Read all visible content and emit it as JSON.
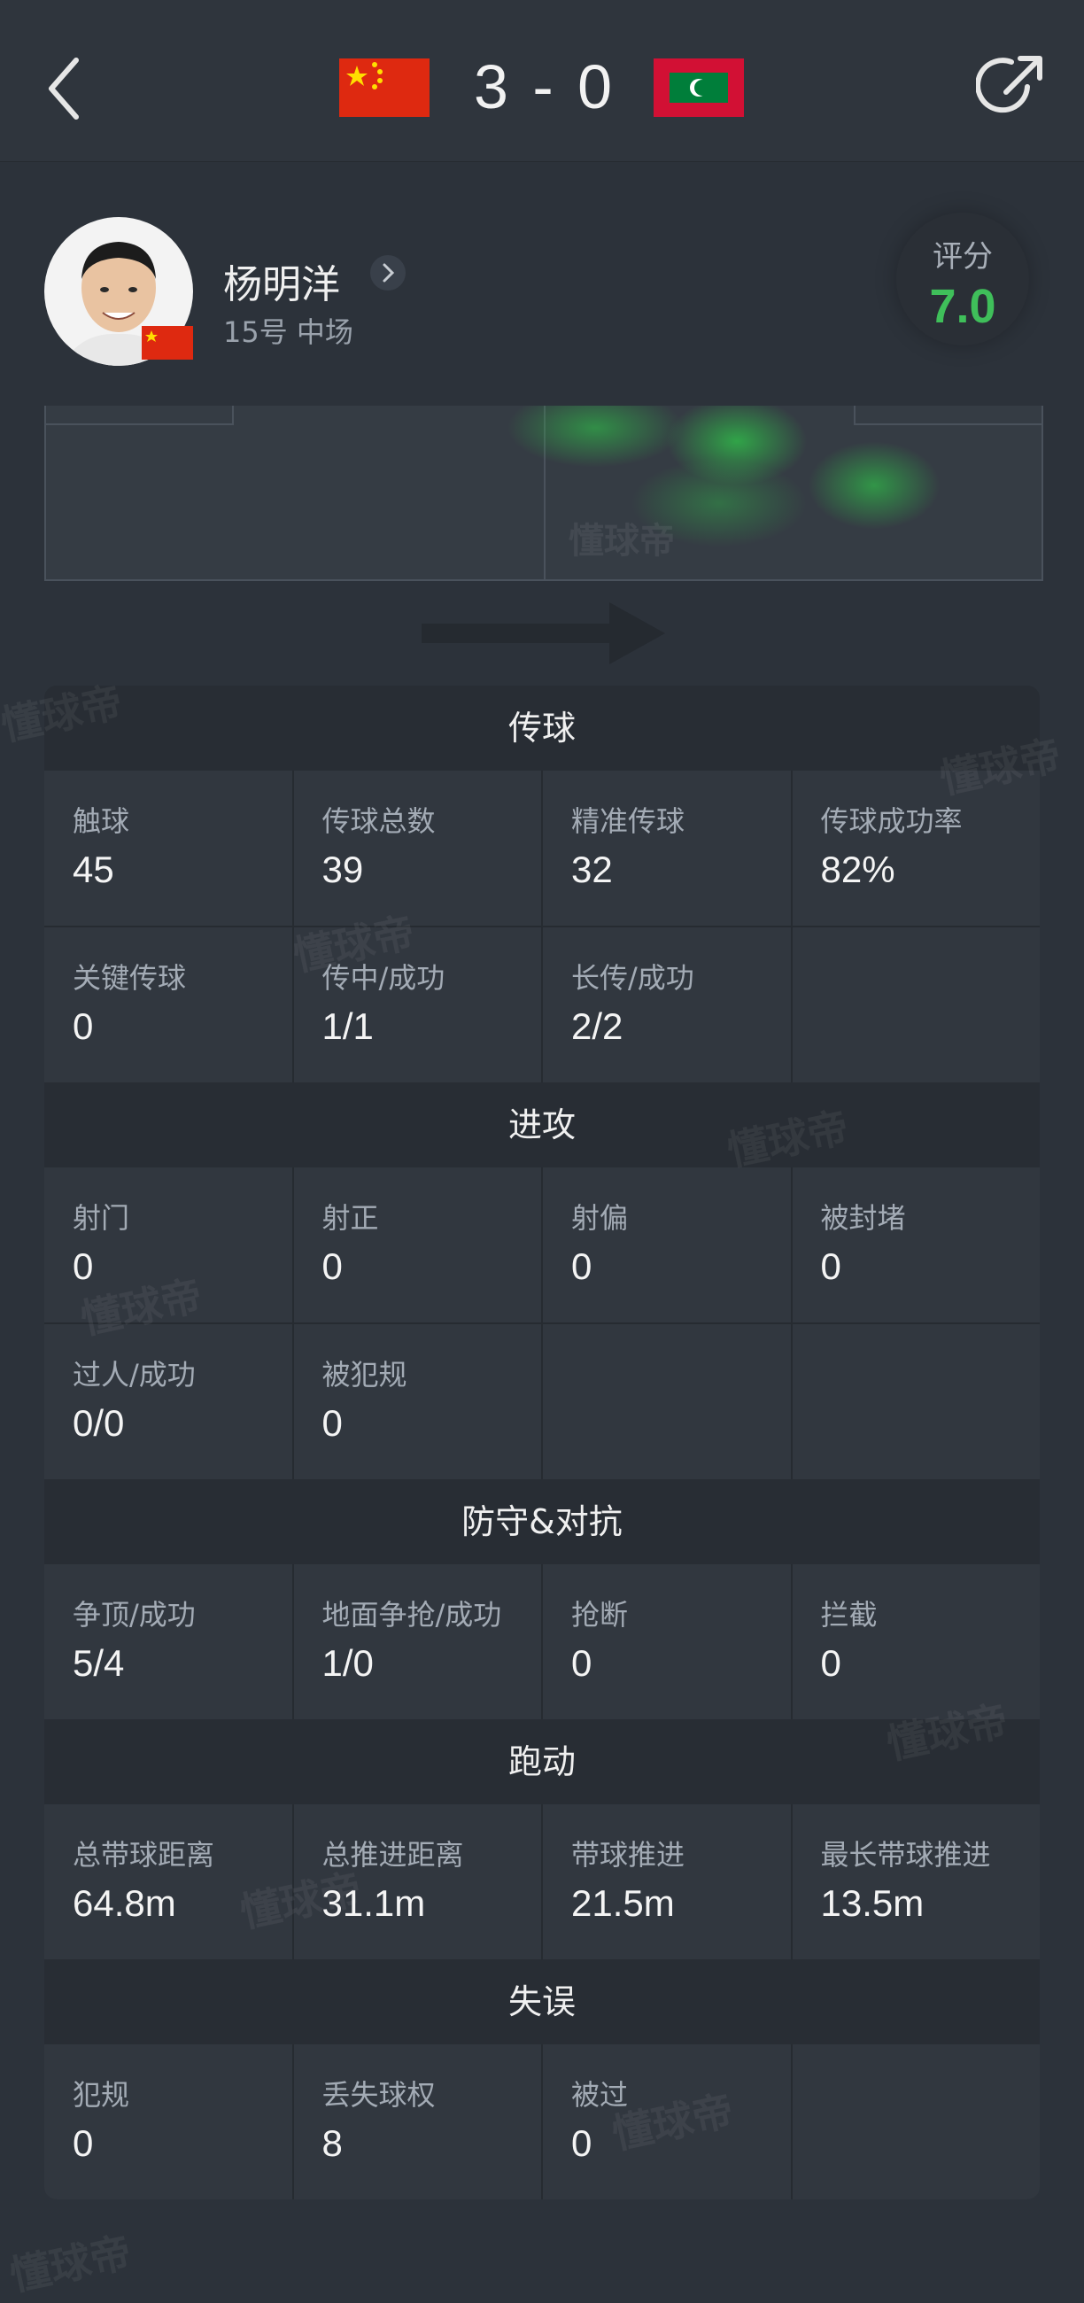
{
  "header": {
    "home_score": "3",
    "away_score": "0",
    "separator": "-"
  },
  "player": {
    "name": "杨明洋",
    "meta": "15号 中场",
    "rating_label": "评分",
    "rating_value": "7.0"
  },
  "watermark": "懂球帝",
  "sections": [
    {
      "title": "传球",
      "rows": [
        [
          {
            "label": "触球",
            "value": "45"
          },
          {
            "label": "传球总数",
            "value": "39"
          },
          {
            "label": "精准传球",
            "value": "32"
          },
          {
            "label": "传球成功率",
            "value": "82%"
          }
        ],
        [
          {
            "label": "关键传球",
            "value": "0"
          },
          {
            "label": "传中/成功",
            "value": "1/1"
          },
          {
            "label": "长传/成功",
            "value": "2/2"
          },
          {
            "label": "",
            "value": ""
          }
        ]
      ]
    },
    {
      "title": "进攻",
      "rows": [
        [
          {
            "label": "射门",
            "value": "0"
          },
          {
            "label": "射正",
            "value": "0"
          },
          {
            "label": "射偏",
            "value": "0"
          },
          {
            "label": "被封堵",
            "value": "0"
          }
        ],
        [
          {
            "label": "过人/成功",
            "value": "0/0"
          },
          {
            "label": "被犯规",
            "value": "0"
          },
          {
            "label": "",
            "value": ""
          },
          {
            "label": "",
            "value": ""
          }
        ]
      ]
    },
    {
      "title": "防守&对抗",
      "rows": [
        [
          {
            "label": "争顶/成功",
            "value": "5/4"
          },
          {
            "label": "地面争抢/成功",
            "value": "1/0"
          },
          {
            "label": "抢断",
            "value": "0"
          },
          {
            "label": "拦截",
            "value": "0"
          }
        ]
      ]
    },
    {
      "title": "跑动",
      "rows": [
        [
          {
            "label": "总带球距离",
            "value": "64.8m"
          },
          {
            "label": "总推进距离",
            "value": "31.1m"
          },
          {
            "label": "带球推进",
            "value": "21.5m"
          },
          {
            "label": "最长带球推进",
            "value": "13.5m"
          }
        ]
      ]
    },
    {
      "title": "失误",
      "rows": [
        [
          {
            "label": "犯规",
            "value": "0"
          },
          {
            "label": "丢失球权",
            "value": "8"
          },
          {
            "label": "被过",
            "value": "0"
          },
          {
            "label": "",
            "value": ""
          }
        ]
      ]
    }
  ],
  "colors": {
    "background": "#2c323a",
    "rating_green": "#3fbf5a",
    "heat_green": "#2fd04a"
  }
}
